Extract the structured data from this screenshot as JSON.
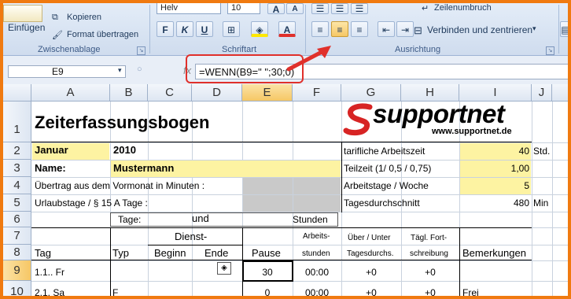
{
  "ribbon": {
    "clipboard": {
      "paste_label": "Einfügen",
      "copy_label": "Kopieren",
      "format_painter_label": "Format übertragen",
      "group_label": "Zwischenablage"
    },
    "font": {
      "font_name": "Helv",
      "font_size": "10",
      "bold": "F",
      "italic": "K",
      "underline": "U",
      "grow_font": "A",
      "shrink_font": "A",
      "font_color": "A",
      "group_label": "Schriftart"
    },
    "alignment": {
      "wrap_text_label": "Zeilenumbruch",
      "merge_center_label": "Verbinden und zentrieren",
      "group_label": "Ausrichtung"
    }
  },
  "formula_bar": {
    "name_box": "E9",
    "fx": "fx",
    "formula": "=WENN(B9=\" \";30;0)"
  },
  "columns": [
    "A",
    "B",
    "C",
    "D",
    "E",
    "F",
    "G",
    "H",
    "I",
    "J"
  ],
  "rows": [
    "1",
    "2",
    "3",
    "4",
    "5",
    "6",
    "7",
    "8",
    "9",
    "10"
  ],
  "sheet": {
    "title": "Zeiterfassungsbogen",
    "logo_text": "supportnet",
    "logo_url": "www.supportnet.de",
    "month_label": "Januar",
    "year": "2010",
    "name_label": "Name:",
    "name_value": "Mustermann",
    "carryover_label": "Übertrag aus dem Vormonat in Minuten :",
    "vacation_label": "Urlaubstage / § 15 A Tage :",
    "days_label": "Tage:",
    "und_label": "und",
    "hours_label": "Stunden",
    "tarif_label": "tarifliche Arbeitszeit",
    "tarif_value": "40",
    "tarif_unit": "Std.",
    "teilzeit_label": "Teilzeit (1/  0,5 / 0,75)",
    "teilzeit_value": "1,00",
    "workdays_label": "Arbeitstage / Woche",
    "workdays_value": "5",
    "daily_avg_label": "Tagesdurchschnitt",
    "daily_avg_value": "480",
    "daily_avg_unit": "Min",
    "headers": {
      "tag": "Tag",
      "typ": "Typ",
      "dienst": "Dienst-",
      "beginn": "Beginn",
      "ende": "Ende",
      "pause": "Pause",
      "arbeits": "Arbeits-",
      "stunden": "stunden",
      "ueber": "Über / Unter",
      "tagesdurchs": "Tagesdurchs.",
      "taegl": "Tägl. Fort-",
      "schreibung": "schreibung",
      "bemerkungen": "Bemerkungen"
    },
    "row9": {
      "tag": "1.1.. Fr",
      "pause": "30",
      "stunden": "00:00",
      "ueber": "+0",
      "fort": "+0"
    },
    "row10": {
      "tag": "2.1. Sa",
      "typ": "F",
      "pause": "0",
      "stunden": "00:00",
      "ueber": "+0",
      "fort": "+0",
      "bemerkung": "Frei"
    }
  },
  "colors": {
    "accent_red": "#e0302b",
    "highlight_yellow": "#fdf3a2",
    "border_orange": "#f07a10"
  }
}
